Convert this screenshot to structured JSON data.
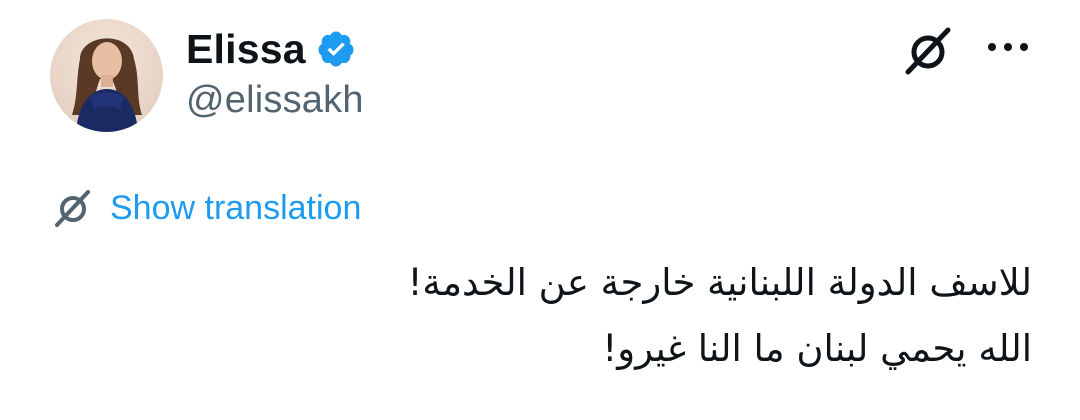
{
  "author": {
    "display_name": "Elissa",
    "handle": "@elissakh",
    "verified": true,
    "avatar_icon": "profile-photo",
    "verified_color": "#1d9bf0"
  },
  "actions": {
    "grok_icon": "grok-icon",
    "more_icon": "more-horizontal-icon"
  },
  "translation": {
    "icon": "grok-icon",
    "label": "Show translation",
    "color": "#1d9bf0"
  },
  "tweet": {
    "lines": [
      "للاسف الدولة اللبنانية خارجة عن الخدمة!",
      "الله يحمي لبنان ما النا غيرو!"
    ]
  }
}
